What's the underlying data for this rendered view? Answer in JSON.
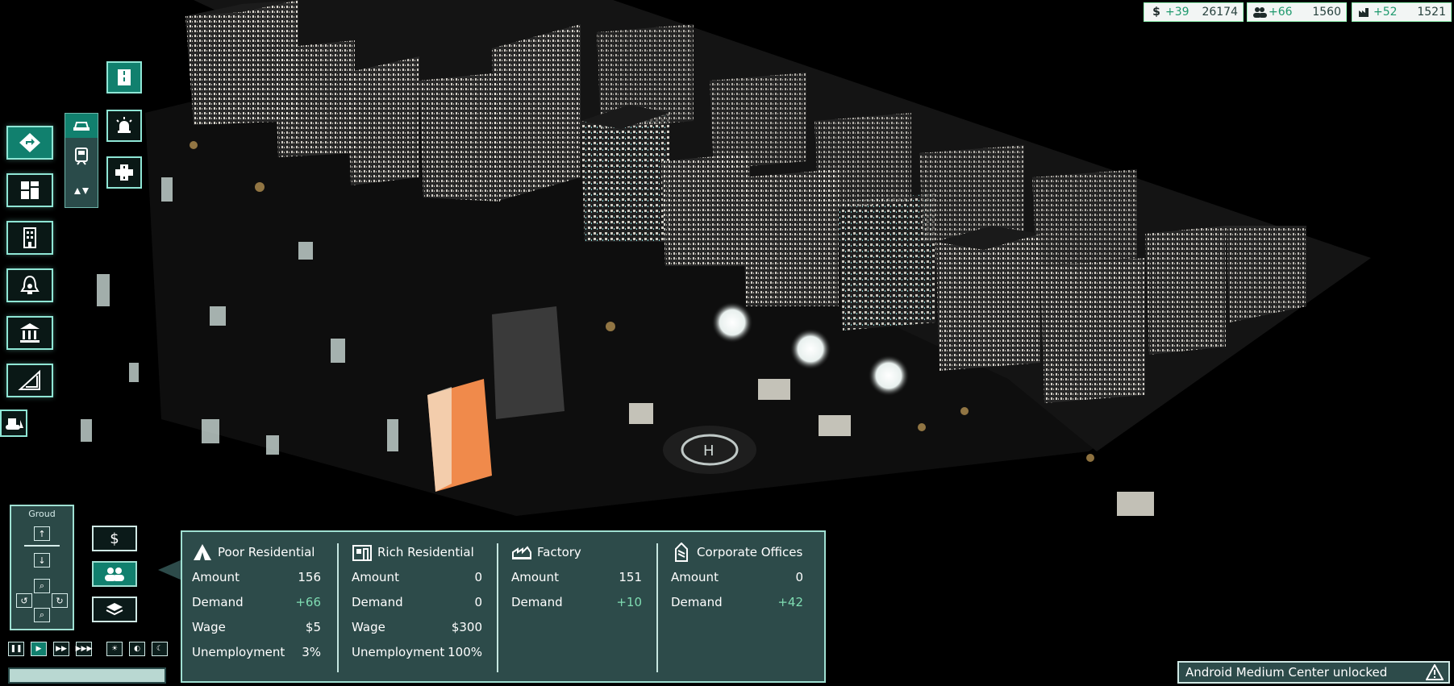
{
  "resources": {
    "money": {
      "icon": "dollar-icon",
      "delta": "+39",
      "value": "26174"
    },
    "population": {
      "icon": "people-icon",
      "delta": "+66",
      "value": "1560"
    },
    "industry": {
      "icon": "factory-icon",
      "delta": "+52",
      "value": "1521"
    }
  },
  "camera": {
    "title": "Groud"
  },
  "demand": {
    "columns": [
      {
        "title": "Poor Residential",
        "icon": "tent-icon",
        "rows": [
          {
            "label": "Amount",
            "value": "156"
          },
          {
            "label": "Demand",
            "value": "+66"
          },
          {
            "label": "Wage",
            "value": "$5"
          },
          {
            "label": "Unemployment",
            "value": "3%"
          }
        ]
      },
      {
        "title": "Rich Residential",
        "icon": "house-icon",
        "rows": [
          {
            "label": "Amount",
            "value": "0"
          },
          {
            "label": "Demand",
            "value": "0"
          },
          {
            "label": "Wage",
            "value": "$300"
          },
          {
            "label": "Unemployment",
            "value": "100%"
          }
        ]
      },
      {
        "title": "Factory",
        "icon": "factory-icon",
        "rows": [
          {
            "label": "Amount",
            "value": "151"
          },
          {
            "label": "Demand",
            "value": "+10"
          }
        ]
      },
      {
        "title": "Corporate Offices",
        "icon": "tower-icon",
        "rows": [
          {
            "label": "Amount",
            "value": "0"
          },
          {
            "label": "Demand",
            "value": "+42"
          }
        ]
      }
    ]
  },
  "notification": {
    "text": "Android Medium Center unlocked"
  },
  "colors": {
    "panel": "#2d4b4a",
    "accent": "#11806e",
    "border": "#9fe0d2",
    "positive": "#7fdcb2"
  }
}
